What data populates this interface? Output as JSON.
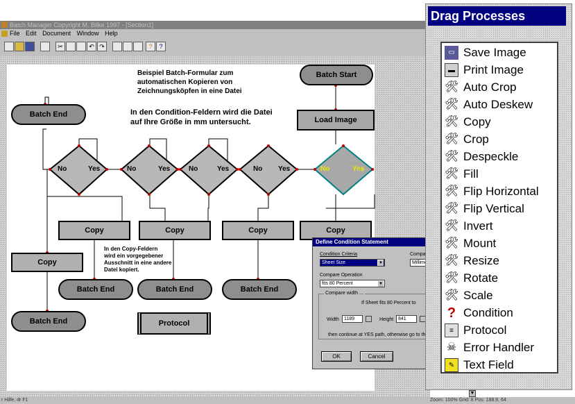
{
  "window": {
    "title": "Batch Manager  Copyright  M. Bilke 1997 - [Section1]",
    "menu": [
      "File",
      "Edit",
      "Document",
      "Window",
      "Help"
    ]
  },
  "status": {
    "left": "r Hilfe, dr F1",
    "right": "Zoom: 100%  Grid: 8    Pos: 188.9, 64"
  },
  "canvas": {
    "notes": {
      "title": "Beispiel Batch-Formular zum\nautomatischen Kopieren von\nZeichnungsköpfen in eine Datei",
      "condition": "In den Condition-Feldern wird die Datei\nauf Ihre Größe in mm untersucht.",
      "copy": "In den Copy-Feldern\nwird ein vorgegebener\nAusschnitt in eine andere\nDatei kopiert."
    },
    "nodes": {
      "batch_start": "Batch Start",
      "load_image": "Load Image",
      "batch_end": "Batch End",
      "copy": "Copy",
      "protocol": "Protocol"
    },
    "diamond_no": "No",
    "diamond_yes": "Yes"
  },
  "dialog": {
    "title": "Define Condition Statement",
    "condition_criteria_label": "Condition Criteria",
    "condition_criteria_value": "Sheet Size",
    "compare_label": "Compar",
    "compare_unit": "Millime",
    "compare_operation_label": "Compare Operation",
    "compare_operation_value": "fits 80 Percent",
    "compare_width_label": "Compare width ...",
    "if_text": "If Sheet fits 80 Percent to",
    "width_label": "Width",
    "width_value": "1189",
    "height_label": "Height",
    "height_value": "841",
    "continue_text": "then continue at YES path, otherwise go to th",
    "ok_label": "OK",
    "cancel_label": "Cancel"
  },
  "palette": {
    "title": "Drag Processes",
    "items": [
      {
        "label": "Save Image",
        "icon": "disk-icon"
      },
      {
        "label": "Print Image",
        "icon": "printer-icon"
      },
      {
        "label": "Auto Crop",
        "icon": "tools-icon"
      },
      {
        "label": "Auto Deskew",
        "icon": "tools-icon"
      },
      {
        "label": "Copy",
        "icon": "tools-icon"
      },
      {
        "label": "Crop",
        "icon": "tools-icon"
      },
      {
        "label": "Despeckle",
        "icon": "tools-icon"
      },
      {
        "label": "Fill",
        "icon": "tools-icon"
      },
      {
        "label": "Flip Horizontal",
        "icon": "tools-icon"
      },
      {
        "label": "Flip Vertical",
        "icon": "tools-icon"
      },
      {
        "label": "Invert",
        "icon": "tools-icon"
      },
      {
        "label": "Mount",
        "icon": "tools-icon"
      },
      {
        "label": "Resize",
        "icon": "tools-icon"
      },
      {
        "label": "Rotate",
        "icon": "tools-icon"
      },
      {
        "label": "Scale",
        "icon": "tools-icon"
      },
      {
        "label": "Condition",
        "icon": "question-icon"
      },
      {
        "label": "Protocol",
        "icon": "document-icon"
      },
      {
        "label": "Error Handler",
        "icon": "skull-icon"
      },
      {
        "label": "Text Field",
        "icon": "note-icon"
      }
    ]
  }
}
